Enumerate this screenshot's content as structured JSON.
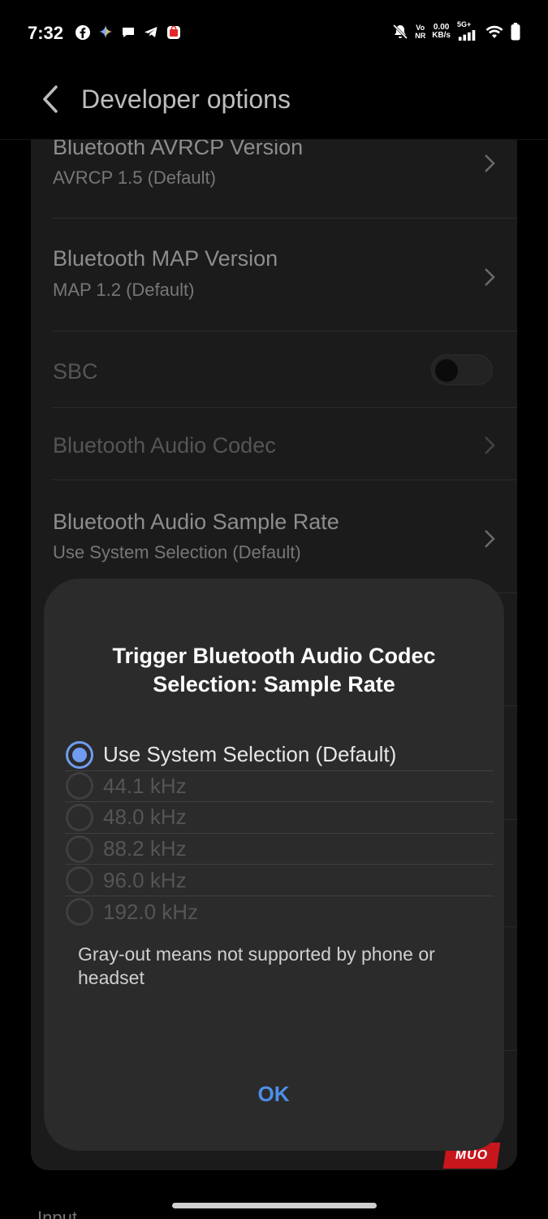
{
  "status_bar": {
    "time": "7:32",
    "left_icons": [
      "facebook-icon",
      "gemini-icon",
      "chat-icon",
      "telegram-icon",
      "shopping-bag-icon"
    ],
    "vo_label": "Vo",
    "nr_label": "NR",
    "data_speed": "0.00",
    "data_unit": "KB/s",
    "network": "5G+"
  },
  "app_bar": {
    "title": "Developer options"
  },
  "settings": {
    "items": [
      {
        "title": "Bluetooth AVRCP Version",
        "subtitle": "AVRCP 1.5 (Default)"
      },
      {
        "title": "Bluetooth MAP Version",
        "subtitle": "MAP 1.2 (Default)"
      },
      {
        "title": "SBC",
        "toggle_on": false
      },
      {
        "title": "Bluetooth Audio Codec"
      },
      {
        "title": "Bluetooth Audio Sample Rate",
        "subtitle": "Use System Selection (Default)"
      }
    ],
    "bottom_label": "Input"
  },
  "dialog": {
    "title": "Trigger Bluetooth Audio Codec Selection: Sample Rate",
    "options": [
      {
        "label": "Use System Selection (Default)",
        "selected": true,
        "enabled": true
      },
      {
        "label": "44.1 kHz",
        "selected": false,
        "enabled": false
      },
      {
        "label": "48.0 kHz",
        "selected": false,
        "enabled": false
      },
      {
        "label": "88.2 kHz",
        "selected": false,
        "enabled": false
      },
      {
        "label": "96.0 kHz",
        "selected": false,
        "enabled": false
      },
      {
        "label": "192.0 kHz",
        "selected": false,
        "enabled": false
      }
    ],
    "note": "Gray-out means not supported by phone or headset",
    "ok_label": "OK"
  },
  "watermark": "MUO",
  "colors": {
    "accent": "#6f9cf0",
    "ok_text": "#4d8fe8",
    "dialog_bg": "#2b2b2b",
    "watermark_bg": "#c8161d"
  }
}
